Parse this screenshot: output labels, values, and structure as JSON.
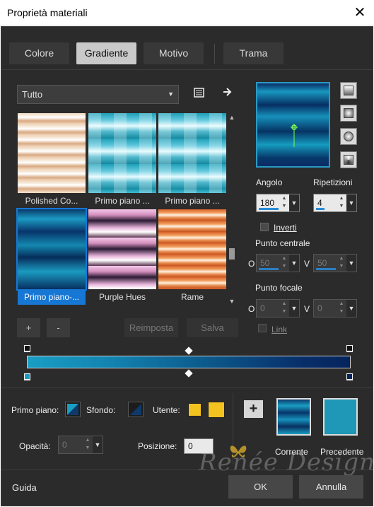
{
  "window": {
    "title": "Proprietà materiali",
    "close_glyph": "✕"
  },
  "tabs": [
    {
      "label": "Colore",
      "active": false
    },
    {
      "label": "Gradiente",
      "active": true
    },
    {
      "label": "Motivo",
      "active": false
    },
    {
      "label": "Trama",
      "active": false
    }
  ],
  "gallery": {
    "category": "Tutto",
    "items": [
      {
        "label": "Polished Co...",
        "selected": false
      },
      {
        "label": "Primo piano ...",
        "selected": false
      },
      {
        "label": "Primo piano ...",
        "selected": false
      },
      {
        "label": "Primo piano-...",
        "selected": true
      },
      {
        "label": "Purple Hues",
        "selected": false
      },
      {
        "label": "Rame",
        "selected": false
      }
    ],
    "add_label": "+",
    "remove_label": "-",
    "reset_label": "Reimposta",
    "save_label": "Salva"
  },
  "gradient": {
    "angle_label": "Angolo",
    "angle": "180",
    "repeats_label": "Ripetizioni",
    "repeats": "4",
    "invert_label": "Inverti",
    "center_label": "Punto centrale",
    "center_h_label": "O",
    "center_h": "50",
    "center_v_label": "V",
    "center_v": "50",
    "focal_label": "Punto focale",
    "focal_h_label": "O",
    "focal_h": "0",
    "focal_v_label": "V",
    "focal_v": "0",
    "link_label": "Link",
    "colors": {
      "start": "#1a9ec3",
      "end": "#06245c"
    }
  },
  "materials": {
    "foreground_label": "Primo piano:",
    "background_label": "Sfondo:",
    "user_label": "Utente:",
    "opacity_label": "Opacità:",
    "opacity": "0",
    "position_label": "Posizione:",
    "position": "0",
    "user_color": "#f2c220",
    "add_label": "+",
    "current_label": "Corrente",
    "previous_label": "Precedente",
    "previous_color": "#1f97b6"
  },
  "footer": {
    "help_label": "Guida",
    "ok_label": "OK",
    "cancel_label": "Annulla"
  },
  "watermark": "Renée Design"
}
